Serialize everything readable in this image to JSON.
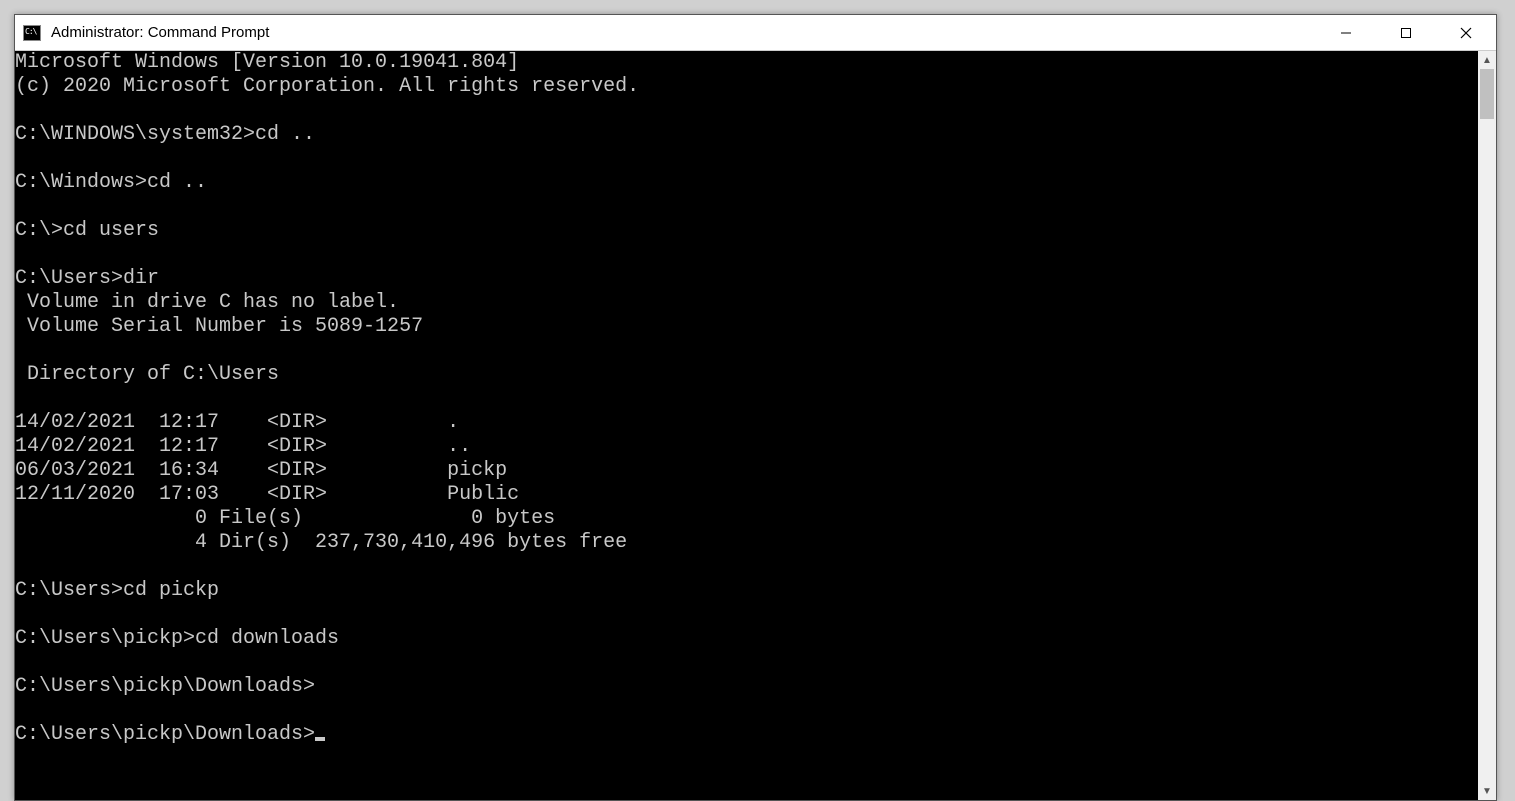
{
  "titlebar": {
    "title": "Administrator: Command Prompt"
  },
  "terminal": {
    "lines": [
      "Microsoft Windows [Version 10.0.19041.804]",
      "(c) 2020 Microsoft Corporation. All rights reserved.",
      "",
      "C:\\WINDOWS\\system32>cd ..",
      "",
      "C:\\Windows>cd ..",
      "",
      "C:\\>cd users",
      "",
      "C:\\Users>dir",
      " Volume in drive C has no label.",
      " Volume Serial Number is 5089-1257",
      "",
      " Directory of C:\\Users",
      "",
      "14/02/2021  12:17    <DIR>          .",
      "14/02/2021  12:17    <DIR>          ..",
      "06/03/2021  16:34    <DIR>          pickp",
      "12/11/2020  17:03    <DIR>          Public",
      "               0 File(s)              0 bytes",
      "               4 Dir(s)  237,730,410,496 bytes free",
      "",
      "C:\\Users>cd pickp",
      "",
      "C:\\Users\\pickp>cd downloads",
      "",
      "C:\\Users\\pickp\\Downloads>",
      ""
    ],
    "current_prompt": "C:\\Users\\pickp\\Downloads>"
  }
}
